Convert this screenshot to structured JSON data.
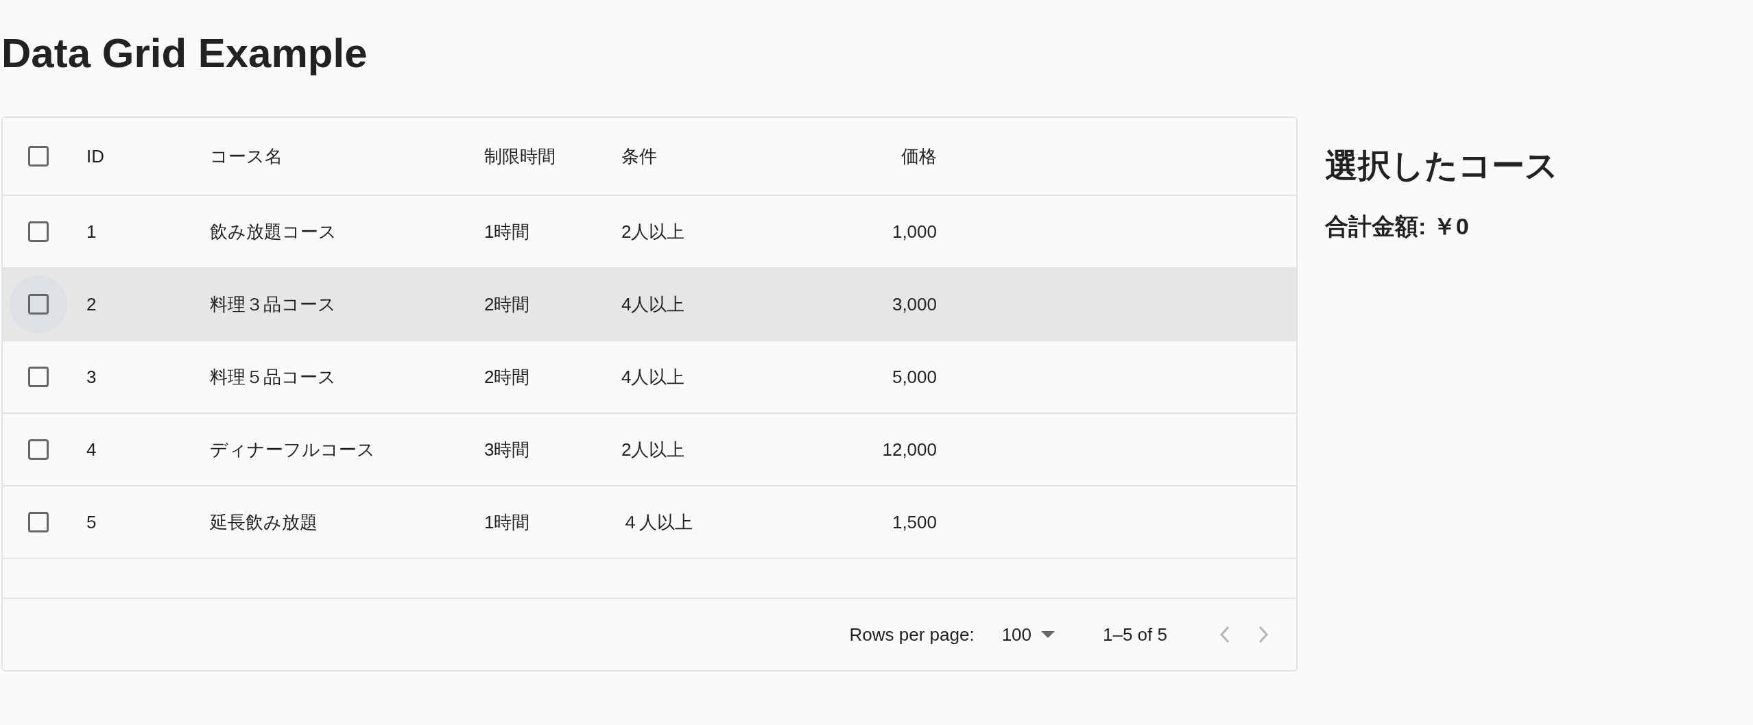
{
  "title": "Data Grid Example",
  "grid": {
    "select_all": {
      "checked": false
    },
    "columns": [
      {
        "label": "ID",
        "kind": "text"
      },
      {
        "label": "コース名",
        "kind": "text"
      },
      {
        "label": "制限時間",
        "kind": "text"
      },
      {
        "label": "条件",
        "kind": "text"
      },
      {
        "label": "価格",
        "kind": "number"
      }
    ],
    "rows": [
      {
        "cells": [
          "1",
          "飲み放題コース",
          "1時間",
          "2人以上",
          "1,000"
        ],
        "checked": false,
        "hovered": false
      },
      {
        "cells": [
          "2",
          "料理３品コース",
          "2時間",
          "4人以上",
          "3,000"
        ],
        "checked": false,
        "hovered": true
      },
      {
        "cells": [
          "3",
          "料理５品コース",
          "2時間",
          "4人以上",
          "5,000"
        ],
        "checked": false,
        "hovered": false
      },
      {
        "cells": [
          "4",
          "ディナーフルコース",
          "3時間",
          "2人以上",
          "12,000"
        ],
        "checked": false,
        "hovered": false
      },
      {
        "cells": [
          "5",
          "延長飲み放題",
          "1時間",
          "４人以上",
          "1,500"
        ],
        "checked": false,
        "hovered": false
      }
    ],
    "footer": {
      "rows_per_page_label": "Rows per page:",
      "rows_per_page": "100",
      "range": "1–5 of 5",
      "prev_disabled": true,
      "next_disabled": true
    }
  },
  "summary": {
    "heading": "選択したコース",
    "total": "合計金額: ￥0"
  }
}
